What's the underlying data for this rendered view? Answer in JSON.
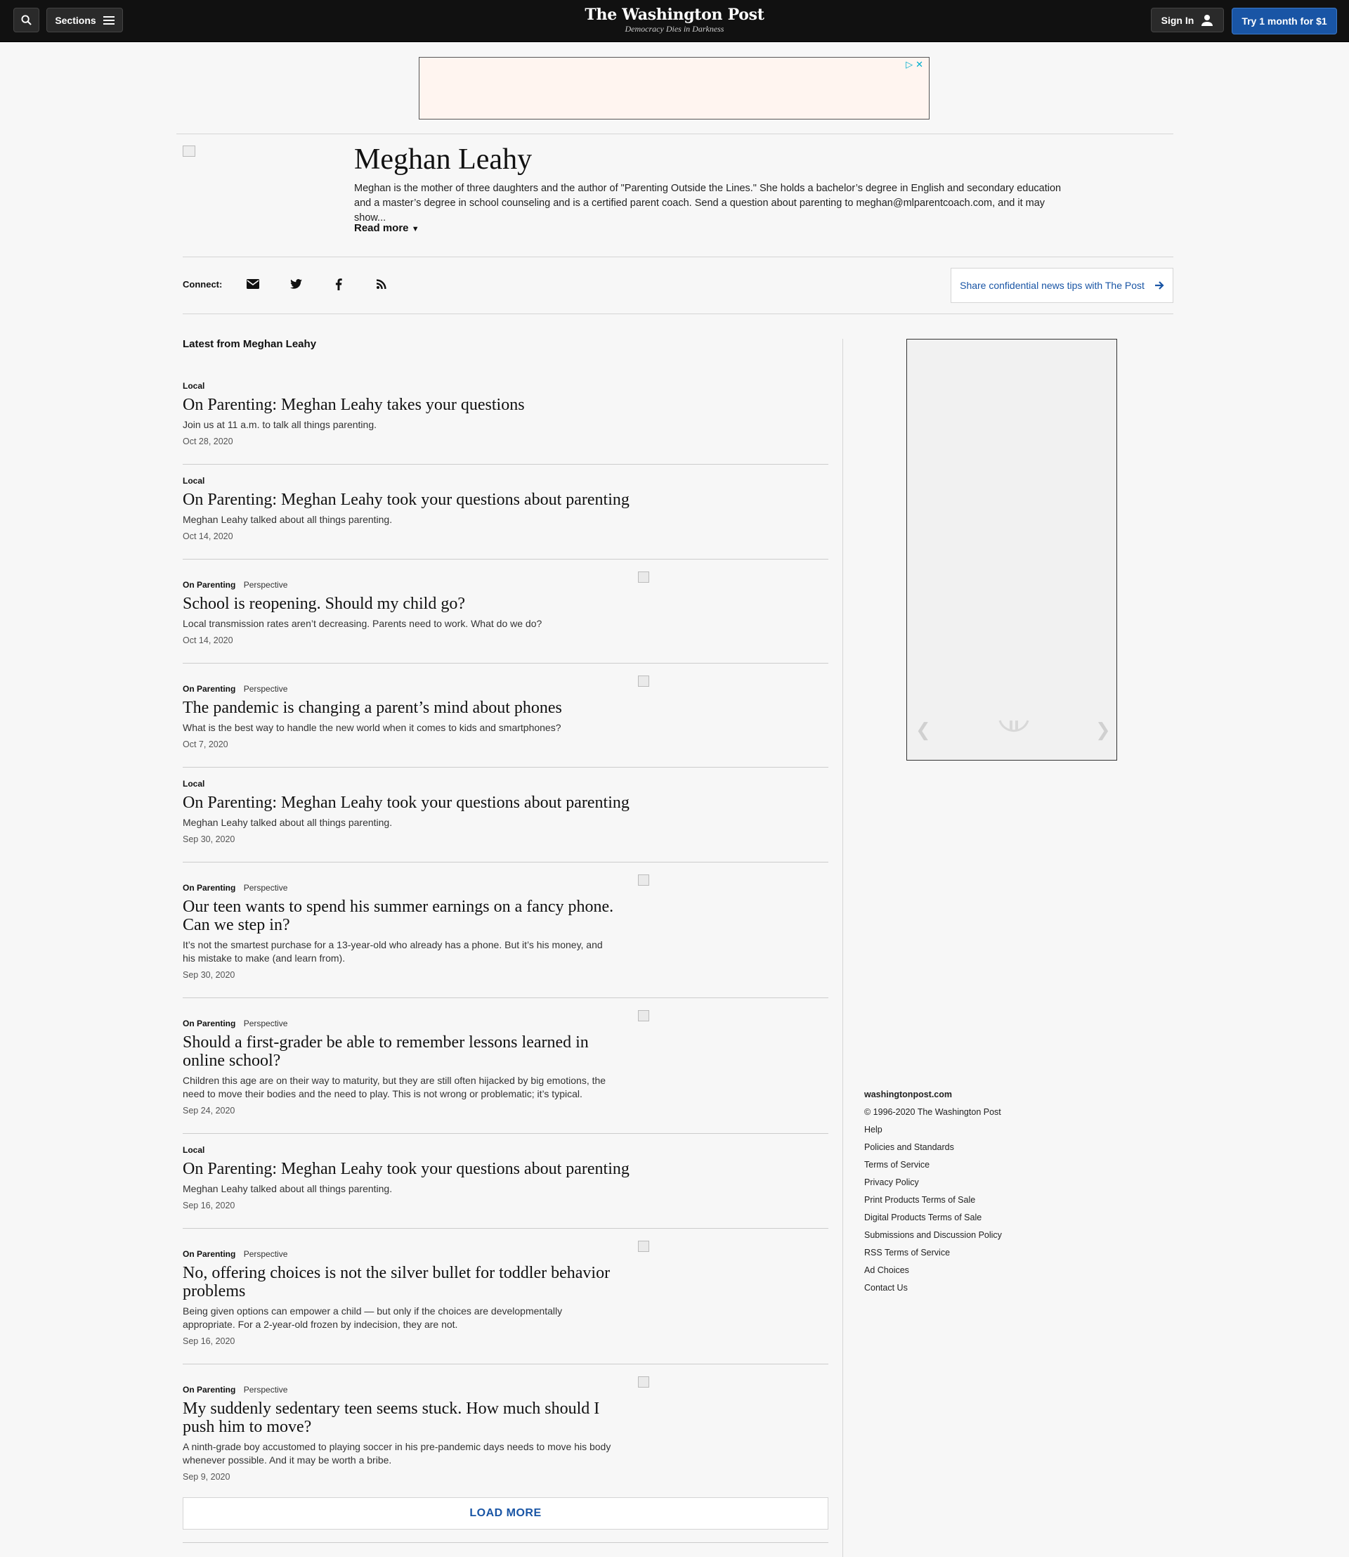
{
  "header": {
    "brand_name": "The Washington Post",
    "tagline": "Democracy Dies in Darkness",
    "sections_label": "Sections",
    "signin_label": "Sign In",
    "subscribe_label": "Try 1 month for $1"
  },
  "author": {
    "name": "Meghan Leahy",
    "bio": "Meghan is the mother of three daughters and the author of \"Parenting Outside the Lines.\" She holds a bachelor’s degree in English and secondary education and a master’s degree in school counseling and is a certified parent coach. Send a question about parenting to meghan@mlparentcoach.com, and it may show...",
    "read_more": "Read more"
  },
  "connect": {
    "label": "Connect:",
    "icons": [
      "email-icon",
      "twitter-icon",
      "facebook-icon",
      "rss-icon"
    ],
    "tips_label": "Share confidential news tips with The Post"
  },
  "latest": {
    "heading": "Latest from Meghan Leahy",
    "stories": [
      {
        "section": "Local",
        "label": "",
        "title": "On Parenting: Meghan Leahy takes your questions",
        "blurb": "Join us at 11 a.m. to talk all things parenting.",
        "date": "Oct 28, 2020"
      },
      {
        "section": "Local",
        "label": "",
        "title": "On Parenting: Meghan Leahy took your questions about parenting",
        "blurb": "Meghan Leahy talked about all things parenting.",
        "date": "Oct 14, 2020"
      },
      {
        "section": "On Parenting",
        "label": "Perspective",
        "title": "School is reopening. Should my child go?",
        "blurb": "Local transmission rates aren’t decreasing. Parents need to work. What do we do?",
        "date": "Oct 14, 2020"
      },
      {
        "section": "On Parenting",
        "label": "Perspective",
        "title": "The pandemic is changing a parent’s mind about phones",
        "blurb": "What is the best way to handle the new world when it comes to kids and smartphones?",
        "date": "Oct 7, 2020"
      },
      {
        "section": "Local",
        "label": "",
        "title": "On Parenting: Meghan Leahy took your questions about parenting",
        "blurb": "Meghan Leahy talked about all things parenting.",
        "date": "Sep 30, 2020"
      },
      {
        "section": "On Parenting",
        "label": "Perspective",
        "title": "Our teen wants to spend his summer earnings on a fancy phone. Can we step in?",
        "blurb": "It’s not the smartest purchase for a 13-year-old who already has a phone. But it’s his money, and his mistake to make (and learn from).",
        "date": "Sep 30, 2020"
      },
      {
        "section": "On Parenting",
        "label": "Perspective",
        "title": "Should a first-grader be able to remember lessons learned in online school?",
        "blurb": "Children this age are on their way to maturity, but they are still often hijacked by big emotions, the need to move their bodies and the need to play. This is not wrong or problematic; it’s typical.",
        "date": "Sep 24, 2020"
      },
      {
        "section": "Local",
        "label": "",
        "title": "On Parenting: Meghan Leahy took your questions about parenting",
        "blurb": "Meghan Leahy talked about all things parenting.",
        "date": "Sep 16, 2020"
      },
      {
        "section": "On Parenting",
        "label": "Perspective",
        "title": "No, offering choices is not the silver bullet for toddler behavior problems",
        "blurb": "Being given options can empower a child — but only if the choices are developmentally appropriate. For a 2-year-old frozen by indecision, they are not.",
        "date": "Sep 16, 2020"
      },
      {
        "section": "On Parenting",
        "label": "Perspective",
        "title": "My suddenly sedentary teen seems stuck. How much should I push him to move?",
        "blurb": "A ninth-grade boy accustomed to playing soccer in his pre-pandemic days needs to move his body whenever possible. And it may be worth a bribe.",
        "date": "Sep 9, 2020"
      }
    ],
    "load_more": "LOAD MORE"
  },
  "footer": {
    "site": "washingtonpost.com",
    "copyright": "© 1996-2020 The Washington Post",
    "links": [
      "Help",
      "Policies and Standards",
      "Terms of Service",
      "Privacy Policy",
      "Print Products Terms of Sale",
      "Digital Products Terms of Sale",
      "Submissions and Discussion Policy",
      "RSS Terms of Service",
      "Ad Choices",
      "Contact Us"
    ]
  },
  "colors": {
    "topbar": "#111111",
    "accent_blue": "#1955a5",
    "background": "#f7f7f7"
  }
}
